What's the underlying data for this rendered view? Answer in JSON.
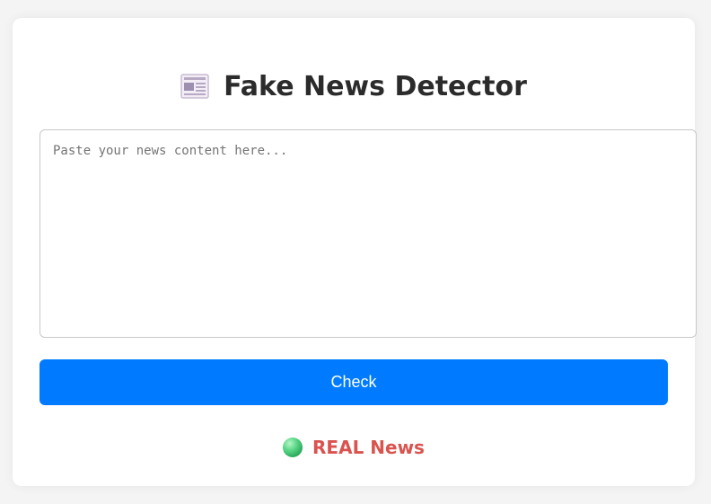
{
  "app": {
    "title": "Fake News Detector",
    "title_icon": "newspaper-icon"
  },
  "form": {
    "news_input_placeholder": "Paste your news content here...",
    "news_input_value": "",
    "check_button_label": "Check"
  },
  "result": {
    "status_icon": "green-circle-icon",
    "label": "REAL News",
    "label_color": "#d9534f"
  },
  "colors": {
    "accent": "#007bff",
    "background": "#f4f4f4",
    "card": "#ffffff"
  }
}
